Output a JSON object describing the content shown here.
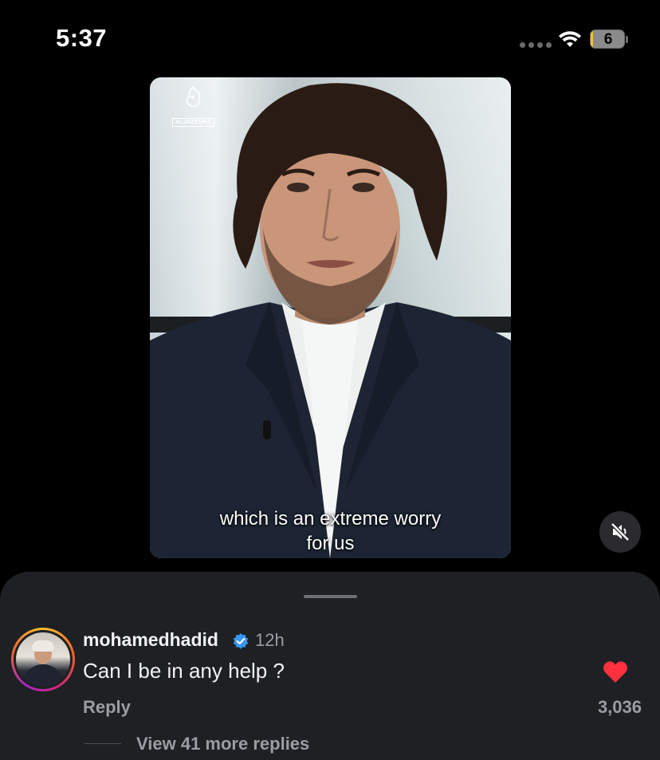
{
  "status_bar": {
    "time": "5:37",
    "battery_level": "6",
    "battery_fraction": 0.06,
    "icons": [
      "cellular-signal-icon",
      "wifi-icon",
      "battery-icon"
    ]
  },
  "video": {
    "logo_text": "ALJAZEERA",
    "caption_line1": "which is an extreme worry",
    "caption_line2": "for us",
    "mute_icon": "speaker-muted-icon"
  },
  "comment": {
    "username": "mohamedhadid",
    "verified": true,
    "age": "12h",
    "text": "Can I be in any help ?",
    "reply_label": "Reply",
    "like_count": "3,036",
    "liked": true,
    "view_more_label": "View 41 more replies"
  },
  "colors": {
    "background": "#000000",
    "sheet": "#1e2023",
    "muted_text": "#9a9da2",
    "verified_blue": "#3897f0",
    "like_red": "#ff3040",
    "battery_low": "#f2c232"
  }
}
